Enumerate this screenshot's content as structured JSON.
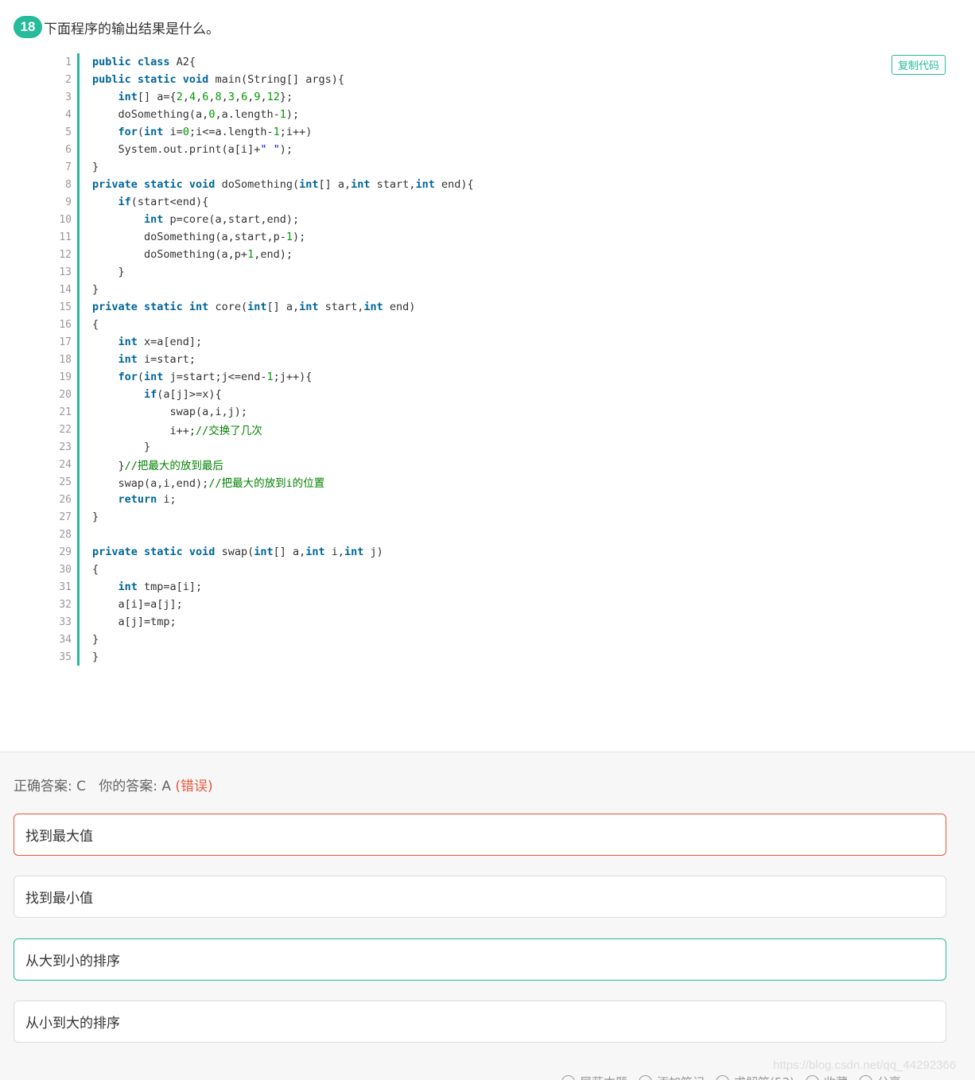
{
  "question": {
    "number": "18",
    "title": "下面程序的输出结果是什么。",
    "copy_label": "复制代码"
  },
  "code_lines": [
    [
      "kw:public class ",
      "A2{"
    ],
    [
      "kw:public static void ",
      "main(String[] args){"
    ],
    [
      "    ",
      "kw:int",
      "[] a={",
      "num:2",
      ",",
      "num:4",
      ",",
      "num:6",
      ",",
      "num:8",
      ",",
      "num:3",
      ",",
      "num:6",
      ",",
      "num:9",
      ",",
      "num:12",
      "};"
    ],
    [
      "    doSomething(a,",
      "num:0",
      ",a.length-",
      "num:1",
      ");"
    ],
    [
      "    ",
      "kw:for",
      "(",
      "kw:int",
      " i=",
      "num:0",
      ";i<=a.length-",
      "num:1",
      ";i++)"
    ],
    [
      "    System.out.print(a[i]+",
      "str:\" \"",
      ");"
    ],
    [
      "}"
    ],
    [
      "kw:private static void ",
      "doSomething(",
      "kw:int",
      "[] a,",
      "kw:int",
      " start,",
      "kw:int",
      " end){"
    ],
    [
      "    ",
      "kw:if",
      "(start<end){"
    ],
    [
      "        ",
      "kw:int",
      " p=core(a,start,end);"
    ],
    [
      "        doSomething(a,start,p-",
      "num:1",
      ");"
    ],
    [
      "        doSomething(a,p+",
      "num:1",
      ",end);"
    ],
    [
      "    }"
    ],
    [
      "}"
    ],
    [
      "kw:private static int ",
      "core(",
      "kw:int",
      "[] a,",
      "kw:int",
      " start,",
      "kw:int",
      " end)"
    ],
    [
      "{"
    ],
    [
      "    ",
      "kw:int",
      " x=a[end];"
    ],
    [
      "    ",
      "kw:int",
      " i=start;"
    ],
    [
      "    ",
      "kw:for",
      "(",
      "kw:int",
      " j=start;j<=end-",
      "num:1",
      ";j++){"
    ],
    [
      "        ",
      "kw:if",
      "(a[j]>=x){"
    ],
    [
      "            swap(a,i,j);"
    ],
    [
      "            i++;",
      "cmt://交换了几次"
    ],
    [
      "        }"
    ],
    [
      "    }",
      "cmt://把最大的放到最后"
    ],
    [
      "    swap(a,i,end);",
      "cmt://把最大的放到i的位置"
    ],
    [
      "    ",
      "kw:return",
      " i;"
    ],
    [
      "}"
    ],
    [
      ""
    ],
    [
      "kw:private static void ",
      "swap(",
      "kw:int",
      "[] a,",
      "kw:int",
      " i,",
      "kw:int",
      " j)"
    ],
    [
      "{"
    ],
    [
      "    ",
      "kw:int",
      " tmp=a[i];"
    ],
    [
      "    a[i]=a[j];"
    ],
    [
      "    a[j]=tmp;"
    ],
    [
      "}"
    ],
    [
      "}"
    ]
  ],
  "answer": {
    "correct_label": "正确答案: C",
    "your_label": "你的答案: A",
    "wrong_tag": "(错误)"
  },
  "options": [
    {
      "label": "找到最大值",
      "state": "wrong"
    },
    {
      "label": "找到最小值",
      "state": "normal"
    },
    {
      "label": "从大到小的排序",
      "state": "correct"
    },
    {
      "label": "从小到大的排序",
      "state": "normal"
    }
  ],
  "footer": [
    "屏蔽本题",
    "添加笔记",
    "求解答(53)",
    "收藏",
    "分享"
  ],
  "watermark": "https://blog.csdn.net/qq_44292366",
  "colors": {
    "accent": "#25bb9b",
    "error": "#e9573f"
  }
}
